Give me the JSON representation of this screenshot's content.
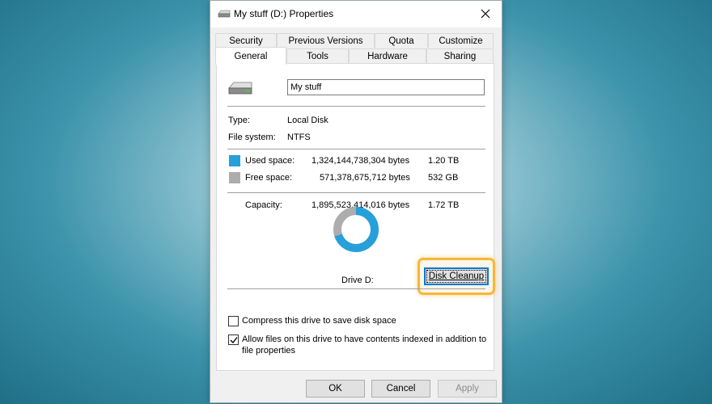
{
  "window": {
    "title": "My stuff (D:) Properties",
    "icon": "drive-icon",
    "close_symbol": "✕"
  },
  "tabs": {
    "row1": [
      "Security",
      "Previous Versions",
      "Quota",
      "Customize"
    ],
    "row2": [
      "General",
      "Tools",
      "Hardware",
      "Sharing"
    ],
    "active": "General"
  },
  "general": {
    "drive_name": "My stuff",
    "type_label": "Type:",
    "type_value": "Local Disk",
    "fs_label": "File system:",
    "fs_value": "NTFS",
    "used_label": "Used space:",
    "used_bytes": "1,324,144,738,304 bytes",
    "used_size": "1.20 TB",
    "free_label": "Free space:",
    "free_bytes": "571,378,675,712 bytes",
    "free_size": "532 GB",
    "capacity_label": "Capacity:",
    "capacity_bytes": "1,895,523,414,016 bytes",
    "capacity_size": "1.72 TB",
    "drive_label": "Drive D:",
    "disk_cleanup": "Disk Cleanup",
    "used_fraction": 0.6986,
    "colors": {
      "used": "#26a0da",
      "free": "#adadad"
    },
    "compress": {
      "label": "Compress this drive to save disk space",
      "checked": false
    },
    "index": {
      "label_line1": "Allow files on this drive to have contents indexed in addition to",
      "label_line2": "file properties",
      "checked": true
    }
  },
  "buttons": {
    "ok": "OK",
    "cancel": "Cancel",
    "apply": "Apply"
  }
}
